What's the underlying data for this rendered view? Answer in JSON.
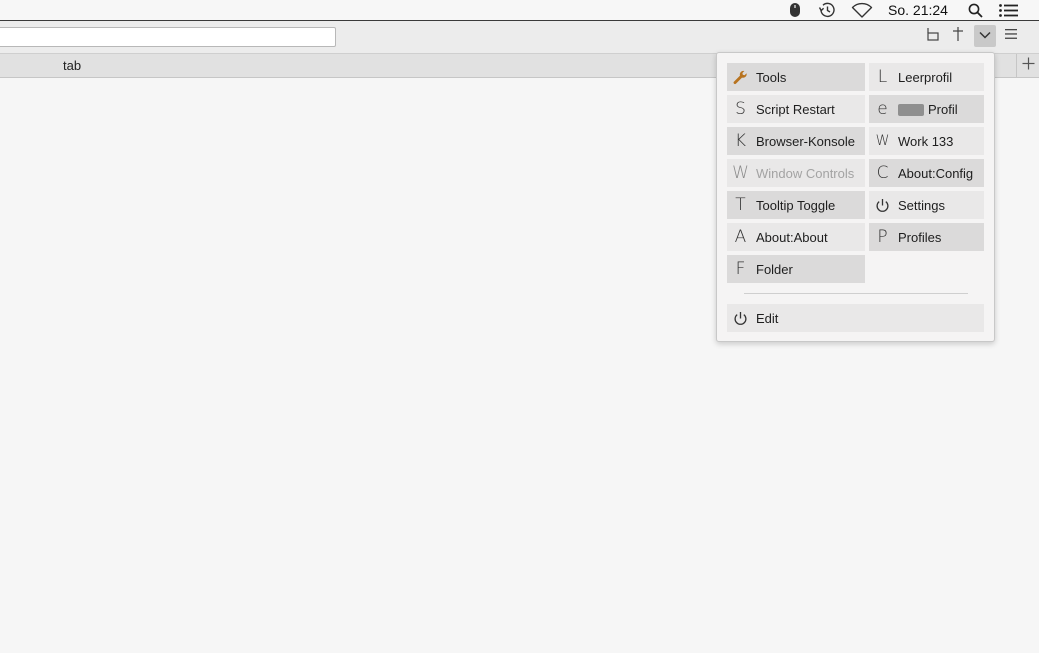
{
  "menubar": {
    "clock": "So. 21:24",
    "icons": [
      "mouse-icon",
      "time-machine-icon",
      "wifi-icon",
      "spotlight-icon",
      "notification-center-icon"
    ]
  },
  "toolbar": {
    "buttons": [
      "sidebar-icon",
      "pin-icon",
      "dropdown-icon",
      "hamburger-menu-icon"
    ]
  },
  "tabs": {
    "active_label": "tab",
    "new_tab_glyph": "+"
  },
  "panel": {
    "left_column": [
      {
        "glyph": "wrench",
        "label": "Tools",
        "enabled": true
      },
      {
        "glyph": "S",
        "label": "Script Restart",
        "enabled": true
      },
      {
        "glyph": "K",
        "label": "Browser-Konsole",
        "enabled": true
      },
      {
        "glyph": "W",
        "label": "Window Controls",
        "enabled": false
      },
      {
        "glyph": "T",
        "label": "Tooltip Toggle",
        "enabled": true
      },
      {
        "glyph": "A",
        "label": "About:About",
        "enabled": true
      },
      {
        "glyph": "F",
        "label": "Folder",
        "enabled": true
      }
    ],
    "right_column": [
      {
        "glyph": "L",
        "label": "Leerprofil",
        "enabled": true
      },
      {
        "glyph": "e",
        "label": "Profil",
        "enabled": true
      },
      {
        "glyph": "W",
        "label": "Work 133",
        "enabled": true
      },
      {
        "glyph": "C",
        "label": "About:Config",
        "enabled": true
      },
      {
        "glyph": "power",
        "label": "Settings",
        "enabled": true
      },
      {
        "glyph": "P",
        "label": "Profiles",
        "enabled": true
      }
    ],
    "footer": {
      "glyph": "power",
      "label": "Edit"
    }
  },
  "colors": {
    "wrench": "#b8731f",
    "panel_bg": "#f5f4f4",
    "button_light": "#e9e8e8",
    "button_dark": "#dbdada",
    "disabled_text": "#a3a3a3"
  }
}
